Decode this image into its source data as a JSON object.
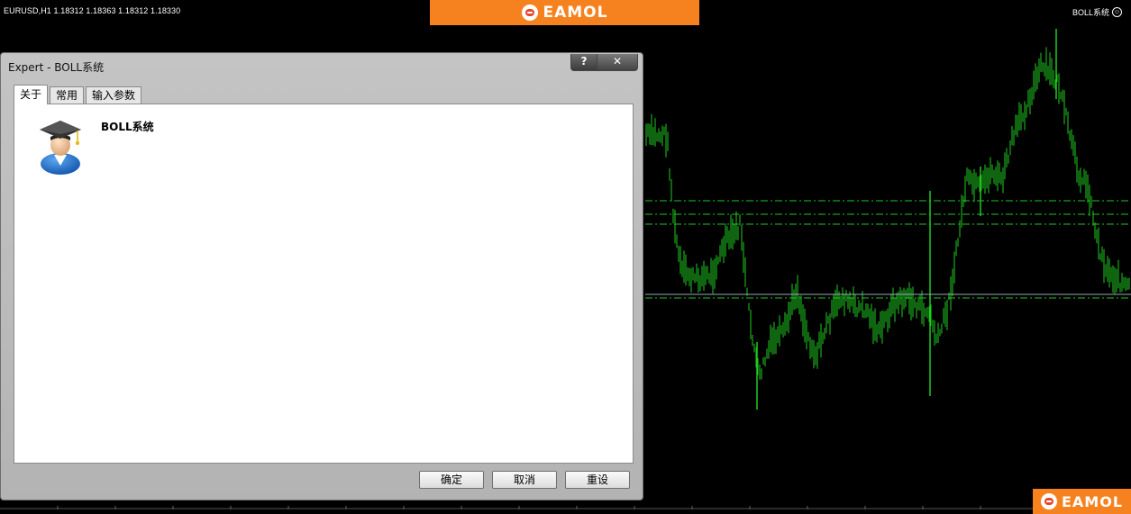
{
  "chart": {
    "info": "EURUSD,H1  1.18312 1.18363 1.18312 1.18330",
    "ea_name": "BOLL系统",
    "smiley": "☺"
  },
  "banner": {
    "text": "EAMOL"
  },
  "corner_logo": {
    "text": "EAMOL"
  },
  "dialog": {
    "title": "Expert - BOLL系统",
    "help_label": "?",
    "close_label": "✕",
    "tabs": [
      {
        "label": "关于"
      },
      {
        "label": "常用"
      },
      {
        "label": "输入参数"
      }
    ],
    "ea_title": "BOLL系统",
    "buttons": {
      "ok": "确定",
      "cancel": "取消",
      "reset": "重设"
    }
  },
  "colors": {
    "bars": "#1fcc1f",
    "banner": "#f6821f"
  }
}
